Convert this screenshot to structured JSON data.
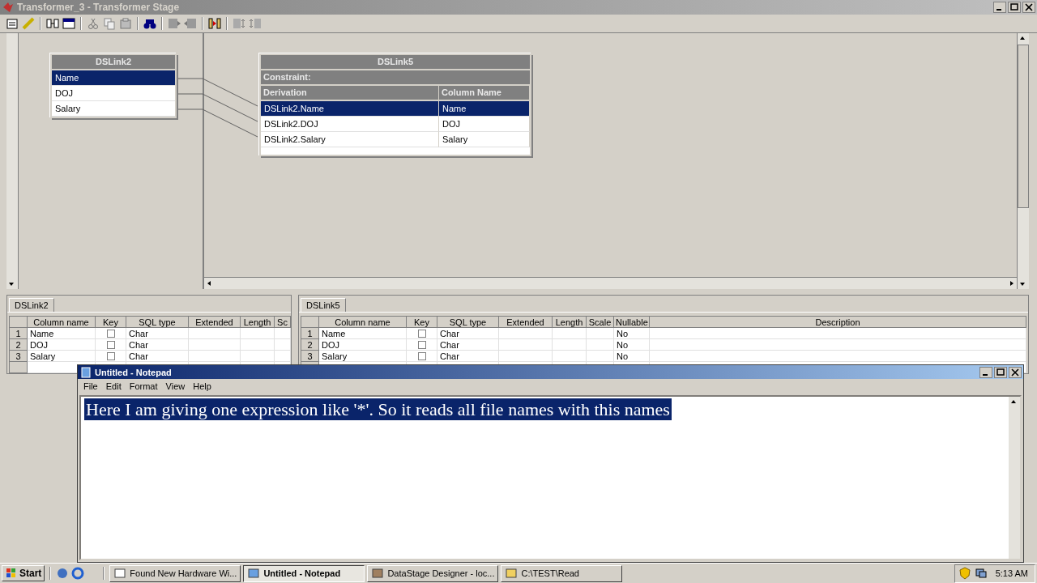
{
  "window": {
    "title": "Transformer_3 - Transformer Stage"
  },
  "input_link": {
    "title": "DSLink2",
    "columns": [
      {
        "name": "Name",
        "selected": true
      },
      {
        "name": "DOJ",
        "selected": false
      },
      {
        "name": "Salary",
        "selected": false
      }
    ]
  },
  "output_link": {
    "title": "DSLink5",
    "constraint_label": "Constraint:",
    "headers": [
      "Derivation",
      "Column Name"
    ],
    "rows": [
      {
        "derivation": "DSLink2.Name",
        "column_name": "Name",
        "selected": true
      },
      {
        "derivation": "DSLink2.DOJ",
        "column_name": "DOJ",
        "selected": false
      },
      {
        "derivation": "DSLink2.Salary",
        "column_name": "Salary",
        "selected": false
      }
    ]
  },
  "grids": [
    {
      "tab": "DSLink2",
      "columns": [
        {
          "label": "Column name",
          "kind": "name"
        },
        {
          "label": "Key",
          "kind": "key"
        },
        {
          "label": "SQL type",
          "kind": "sql_type"
        },
        {
          "label": "Extended",
          "kind": "extended"
        },
        {
          "label": "Length",
          "kind": "length"
        },
        {
          "label": "Sc",
          "kind": "scale"
        }
      ],
      "rows": [
        {
          "index": "1",
          "column_name": "Name",
          "key": false,
          "sql_type": "Char"
        },
        {
          "index": "2",
          "column_name": "DOJ",
          "key": false,
          "sql_type": "Char"
        },
        {
          "index": "3",
          "column_name": "Salary",
          "key": false,
          "sql_type": "Char"
        }
      ]
    },
    {
      "tab": "DSLink5",
      "columns": [
        {
          "label": "Column name",
          "kind": "name"
        },
        {
          "label": "Key",
          "kind": "key"
        },
        {
          "label": "SQL type",
          "kind": "sql_type"
        },
        {
          "label": "Extended",
          "kind": "extended"
        },
        {
          "label": "Length",
          "kind": "length"
        },
        {
          "label": "Scale",
          "kind": "scale"
        },
        {
          "label": "Nullable",
          "kind": "nullable"
        },
        {
          "label": "Description",
          "kind": "description"
        }
      ],
      "rows": [
        {
          "index": "1",
          "column_name": "Name",
          "key": false,
          "sql_type": "Char",
          "nullable": "No"
        },
        {
          "index": "2",
          "column_name": "DOJ",
          "key": false,
          "sql_type": "Char",
          "nullable": "No"
        },
        {
          "index": "3",
          "column_name": "Salary",
          "key": false,
          "sql_type": "Char",
          "nullable": "No"
        }
      ]
    }
  ],
  "notepad": {
    "title": "Untitled - Notepad",
    "menu": [
      "File",
      "Edit",
      "Format",
      "View",
      "Help"
    ],
    "text": "Here I am giving one expression like '*'. So it reads all file names with this names",
    "selected": true
  },
  "taskbar": {
    "start": "Start",
    "tasks": [
      {
        "label": "Found New Hardware Wi...",
        "selected": false
      },
      {
        "label": "Untitled - Notepad",
        "selected": true
      },
      {
        "label": "DataStage Designer - loc...",
        "selected": false
      },
      {
        "label": "C:\\TEST\\Read",
        "selected": false
      }
    ],
    "clock": "5:13 AM"
  }
}
